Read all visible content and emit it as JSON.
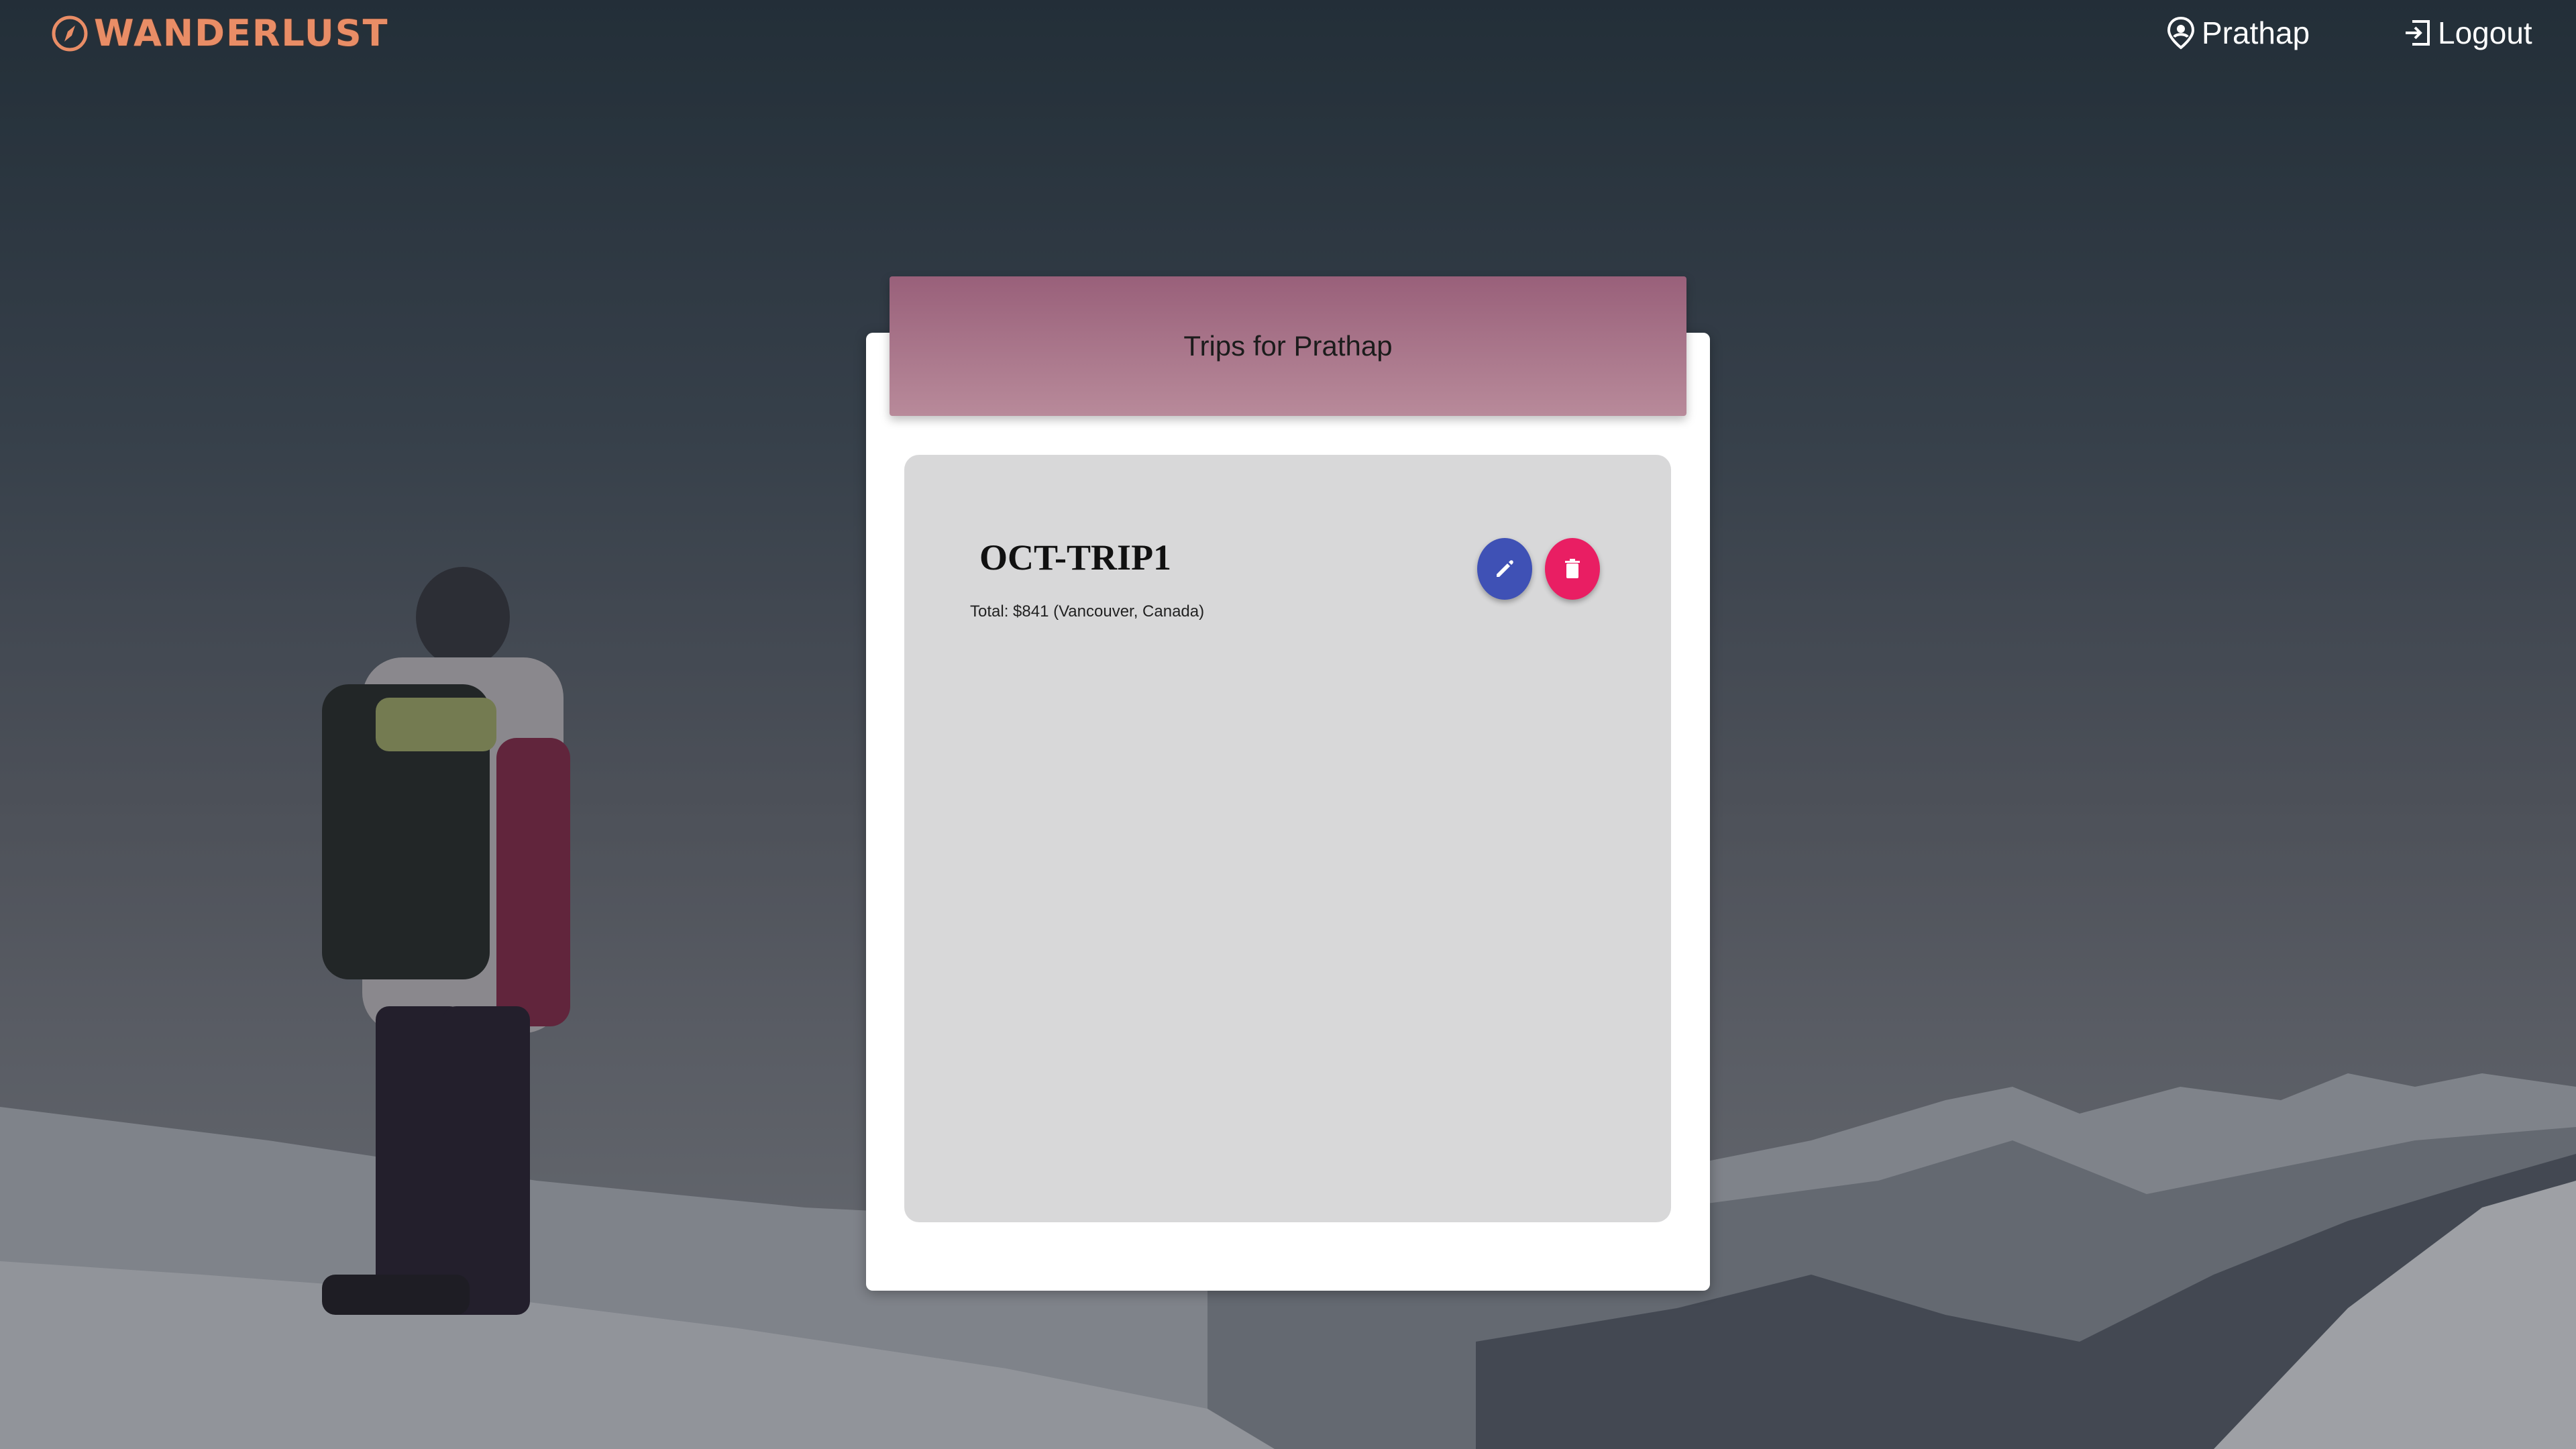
{
  "app": {
    "brand": "WANDERLUST",
    "brand_color": "#e98d66"
  },
  "nav": {
    "user_label": "Prathap",
    "user_icon": "map-pin-icon",
    "logout_label": "Logout",
    "logout_icon": "sign-in-icon"
  },
  "panel": {
    "title": "Trips for Prathap",
    "header_color": "#a97186"
  },
  "trips": [
    {
      "name": "OCT-TRIP1",
      "summary": "Total: $841 (Vancouver, Canada)",
      "edit_icon": "pencil-icon",
      "delete_icon": "trash-icon",
      "edit_color": "#3f51b5",
      "delete_color": "#e91e63"
    }
  ]
}
